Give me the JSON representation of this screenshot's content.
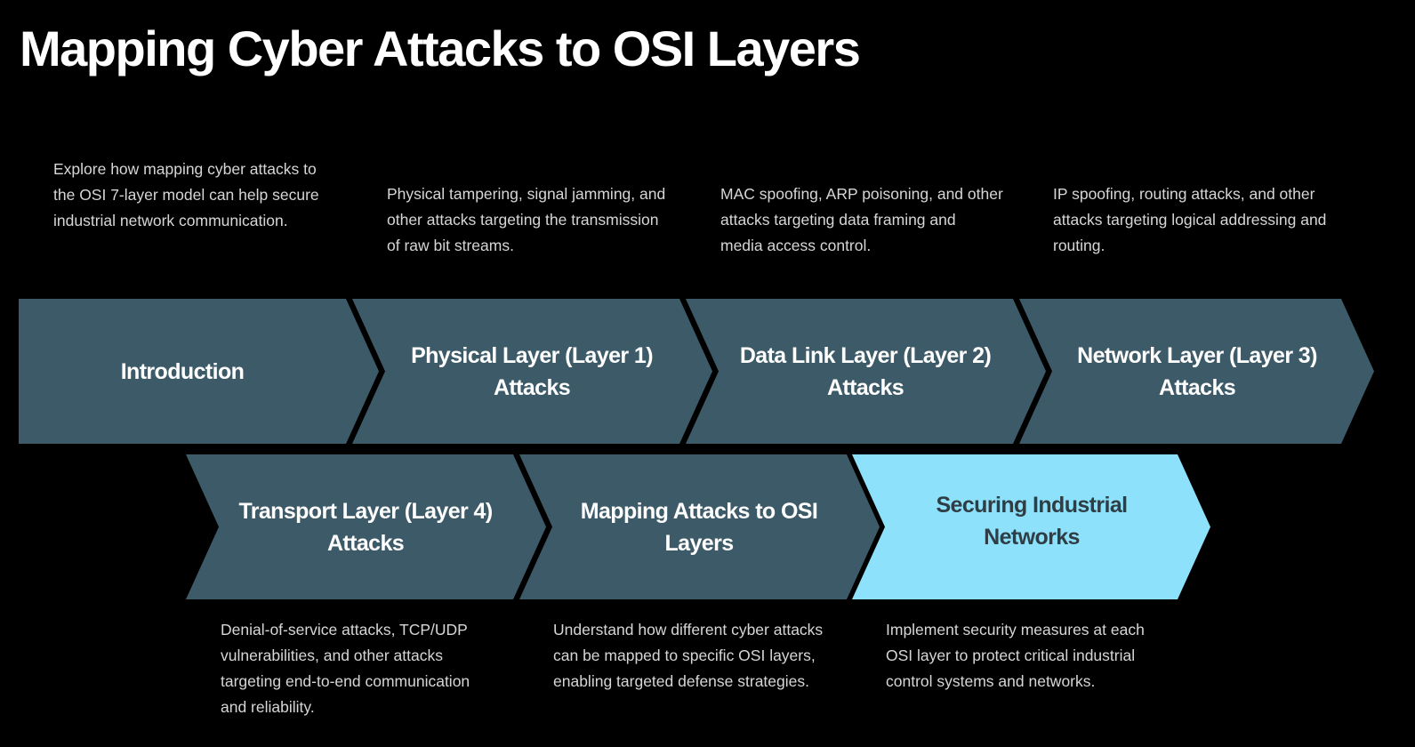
{
  "title": "Mapping Cyber Attacks to OSI Layers",
  "colors": {
    "background": "#000000",
    "step_fill": "#3d5a68",
    "step_fill_active": "#8de1fb",
    "step_text": "#ffffff",
    "step_text_active": "#2f3d45",
    "description_text": "#d6d6d6"
  },
  "steps": [
    {
      "label": "Introduction",
      "description": "Explore how mapping cyber attacks to\nthe OSI 7-layer model can help secure\nindustrial network communication.",
      "active": false
    },
    {
      "label": "Physical Layer (Layer 1)\nAttacks",
      "description": "Physical tampering, signal jamming, and\nother attacks targeting the transmission\nof raw bit streams.",
      "active": false
    },
    {
      "label": "Data Link Layer (Layer 2)\nAttacks",
      "description": "MAC spoofing, ARP poisoning, and other\nattacks targeting data framing and\nmedia access control.",
      "active": false
    },
    {
      "label": "Network Layer (Layer 3)\nAttacks",
      "description": "IP spoofing, routing attacks, and other\nattacks targeting logical addressing and\nrouting.",
      "active": false
    },
    {
      "label": "Transport Layer (Layer 4)\nAttacks",
      "description": "Denial-of-service attacks, TCP/UDP\nvulnerabilities, and other attacks\ntargeting end-to-end communication\nand reliability.",
      "active": false
    },
    {
      "label": "Mapping Attacks to OSI\nLayers",
      "description": "Understand how different cyber attacks\ncan be mapped to specific OSI layers,\nenabling targeted defense strategies.",
      "active": false
    },
    {
      "label": "Securing Industrial\nNetworks",
      "description": "Implement security measures at each\nOSI layer to protect critical industrial\ncontrol systems and networks.",
      "active": true
    }
  ]
}
